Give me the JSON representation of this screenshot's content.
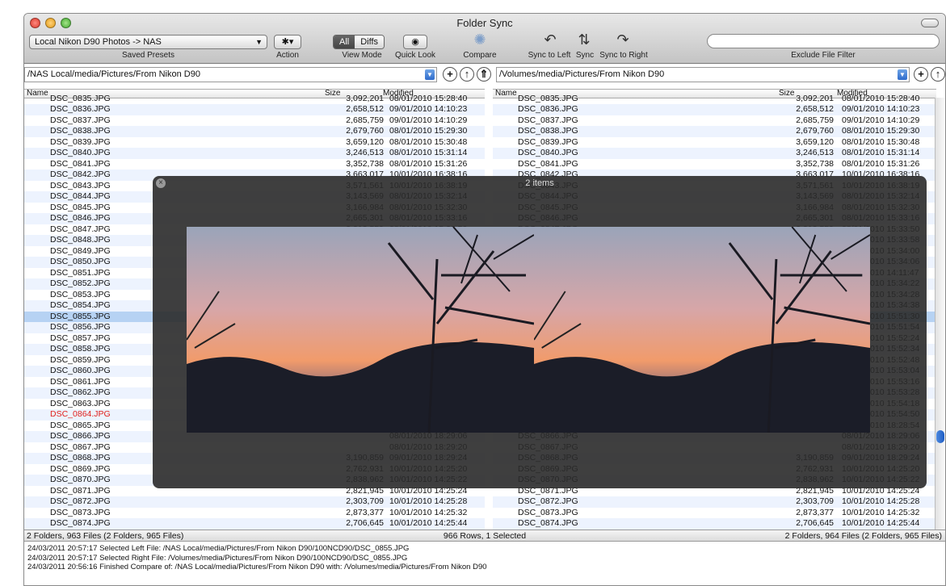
{
  "window": {
    "title": "Folder Sync"
  },
  "toolbar": {
    "preset_value": "Local Nikon D90 Photos -> NAS",
    "saved_presets_label": "Saved Presets",
    "action_label": "Action",
    "view_all": "All",
    "view_diffs": "Diffs",
    "view_mode_label": "View Mode",
    "quick_look_label": "Quick Look",
    "compare_label": "Compare",
    "sync_to_left_label": "Sync to Left",
    "sync_label": "Sync",
    "sync_to_right_label": "Sync to Right",
    "exclude_filter_label": "Exclude File Filter",
    "exclude_filter_value": ""
  },
  "left": {
    "path": "/NAS Local/media/Pictures/From Nikon D90",
    "status": "2 Folders, 963 Files (2 Folders, 965 Files)"
  },
  "right": {
    "path": "/Volumes/media/Pictures/From Nikon D90",
    "status": "2 Folders, 964 Files (2 Folders, 965 Files)"
  },
  "columns": {
    "name": "Name",
    "size": "Size",
    "modified": "Modified"
  },
  "status_center": "966 Rows, 1 Selected",
  "colors": {
    "selected_row": "#b6d2f3",
    "alt_row": "#edf3fe",
    "missing_file": "#e0201c"
  },
  "files": [
    {
      "name": "DSC_0835.JPG",
      "size": "3,092,201",
      "mod": "08/01/2010 15:28:40"
    },
    {
      "name": "DSC_0836.JPG",
      "size": "2,658,512",
      "mod": "09/01/2010 14:10:23"
    },
    {
      "name": "DSC_0837.JPG",
      "size": "2,685,759",
      "mod": "09/01/2010 14:10:29"
    },
    {
      "name": "DSC_0838.JPG",
      "size": "2,679,760",
      "mod": "08/01/2010 15:29:30"
    },
    {
      "name": "DSC_0839.JPG",
      "size": "3,659,120",
      "mod": "08/01/2010 15:30:48"
    },
    {
      "name": "DSC_0840.JPG",
      "size": "3,246,513",
      "mod": "08/01/2010 15:31:14"
    },
    {
      "name": "DSC_0841.JPG",
      "size": "3,352,738",
      "mod": "08/01/2010 15:31:26"
    },
    {
      "name": "DSC_0842.JPG",
      "size": "3,663,017",
      "mod": "10/01/2010 16:38:16"
    },
    {
      "name": "DSC_0843.JPG",
      "size": "3,571,561",
      "mod": "10/01/2010 16:38:19"
    },
    {
      "name": "DSC_0844.JPG",
      "size": "3,143,569",
      "mod": "08/01/2010 15:32:14"
    },
    {
      "name": "DSC_0845.JPG",
      "size": "3,166,984",
      "mod": "08/01/2010 15:32:30"
    },
    {
      "name": "DSC_0846.JPG",
      "size": "2,665,301",
      "mod": "08/01/2010 15:33:16"
    },
    {
      "name": "DSC_0847.JPG",
      "size": "3,212,559",
      "mod": "08/01/2010 15:33:50"
    },
    {
      "name": "DSC_0848.JPG",
      "size": "2,857,028",
      "mod": "08/01/2010 15:33:58"
    },
    {
      "name": "DSC_0849.JPG",
      "size": "",
      "mod": "08/01/2010 15:34:00"
    },
    {
      "name": "DSC_0850.JPG",
      "size": "",
      "mod": "08/01/2010 15:34:06"
    },
    {
      "name": "DSC_0851.JPG",
      "size": "",
      "mod": "08/01/2010 14:11:47"
    },
    {
      "name": "DSC_0852.JPG",
      "size": "",
      "mod": "08/01/2010 15:34:22"
    },
    {
      "name": "DSC_0853.JPG",
      "size": "",
      "mod": "08/01/2010 15:34:28"
    },
    {
      "name": "DSC_0854.JPG",
      "size": "",
      "mod": "08/01/2010 15:34:38"
    },
    {
      "name": "DSC_0855.JPG",
      "size": "",
      "mod": "08/01/2010 15:51:30"
    },
    {
      "name": "DSC_0856.JPG",
      "size": "",
      "mod": "08/01/2010 15:51:54"
    },
    {
      "name": "DSC_0857.JPG",
      "size": "",
      "mod": "08/01/2010 15:52:24"
    },
    {
      "name": "DSC_0858.JPG",
      "size": "",
      "mod": "08/01/2010 15:52:34"
    },
    {
      "name": "DSC_0859.JPG",
      "size": "",
      "mod": "08/01/2010 15:52:48"
    },
    {
      "name": "DSC_0860.JPG",
      "size": "",
      "mod": "08/01/2010 15:53:04"
    },
    {
      "name": "DSC_0861.JPG",
      "size": "",
      "mod": "08/01/2010 15:53:16"
    },
    {
      "name": "DSC_0862.JPG",
      "size": "",
      "mod": "08/01/2010 15:53:28"
    },
    {
      "name": "DSC_0863.JPG",
      "size": "",
      "mod": "08/01/2010 15:54:18"
    },
    {
      "name": "DSC_0864.JPG",
      "size": "",
      "mod": "08/01/2010 15:54:50"
    },
    {
      "name": "DSC_0865.JPG",
      "size": "",
      "mod": "08/01/2010 18:28:54"
    },
    {
      "name": "DSC_0866.JPG",
      "size": "",
      "mod": "08/01/2010 18:29:06"
    },
    {
      "name": "DSC_0867.JPG",
      "size": "",
      "mod": "08/01/2010 18:29:20"
    },
    {
      "name": "DSC_0868.JPG",
      "size": "3,190,859",
      "mod": "09/01/2010 18:29:24"
    },
    {
      "name": "DSC_0869.JPG",
      "size": "2,762,931",
      "mod": "10/01/2010 14:25:20"
    },
    {
      "name": "DSC_0870.JPG",
      "size": "2,838,962",
      "mod": "10/01/2010 14:25:22"
    },
    {
      "name": "DSC_0871.JPG",
      "size": "2,821,945",
      "mod": "10/01/2010 14:25:24"
    },
    {
      "name": "DSC_0872.JPG",
      "size": "2,303,709",
      "mod": "10/01/2010 14:25:28"
    },
    {
      "name": "DSC_0873.JPG",
      "size": "2,873,377",
      "mod": "10/01/2010 14:25:32"
    },
    {
      "name": "DSC_0874.JPG",
      "size": "2,706,645",
      "mod": "10/01/2010 14:25:44"
    },
    {
      "name": "DSC_0875.JPG",
      "size": "2,834,622",
      "mod": "10/01/2010 14:25:52"
    }
  ],
  "selected_file": "DSC_0855.JPG",
  "missing_left": "DSC_0864.JPG",
  "quicklook": {
    "title": "2 items"
  },
  "log": [
    "24/03/2011 20:57:17  Selected Left File: /NAS Local/media/Pictures/From Nikon D90/100NCD90/DSC_0855.JPG",
    "24/03/2011 20:57:17  Selected Right File: /Volumes/media/Pictures/From Nikon D90/100NCD90/DSC_0855.JPG",
    "24/03/2011 20:56:16  Finished Compare of: /NAS Local/media/Pictures/From Nikon D90 with: /Volumes/media/Pictures/From Nikon D90"
  ]
}
